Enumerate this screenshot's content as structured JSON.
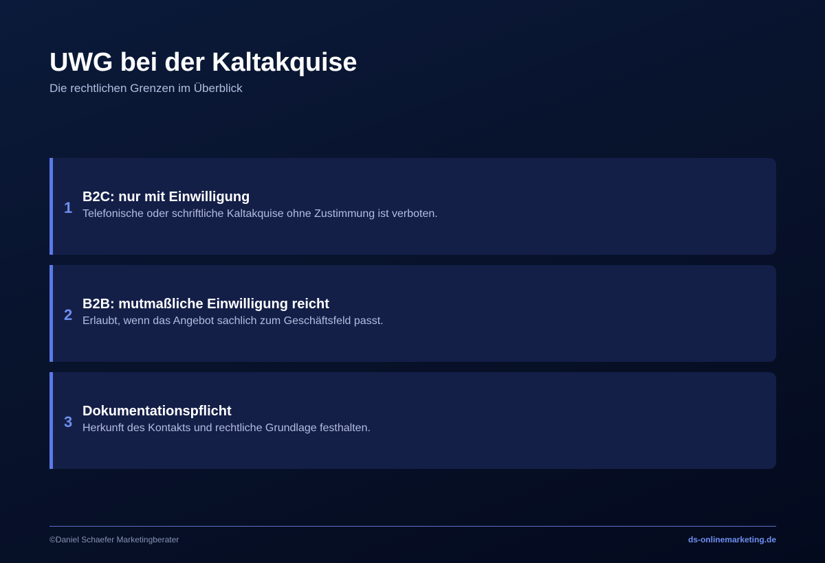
{
  "header": {
    "title": "UWG bei der Kaltakquise",
    "subtitle": "Die rechtlichen Grenzen im Überblick"
  },
  "cards": [
    {
      "number": "1",
      "title": "B2C: nur mit Einwilligung",
      "description": "Telefonische oder schriftliche Kaltakquise ohne Zustimmung ist verboten."
    },
    {
      "number": "2",
      "title": "B2B: mutmaßliche Einwilligung reicht",
      "description": "Erlaubt, wenn das Angebot sachlich zum Geschäftsfeld passt."
    },
    {
      "number": "3",
      "title": "Dokumentationspflicht",
      "description": "Herkunft des Kontakts und rechtliche Grundlage festhalten."
    }
  ],
  "footer": {
    "copyright": "©Daniel Schaefer Marketingberater",
    "website": "ds-onlinemarketing.de"
  },
  "colors": {
    "accent": "#5b7ae8",
    "card_background": "#141f48",
    "page_background": "#08132c"
  }
}
